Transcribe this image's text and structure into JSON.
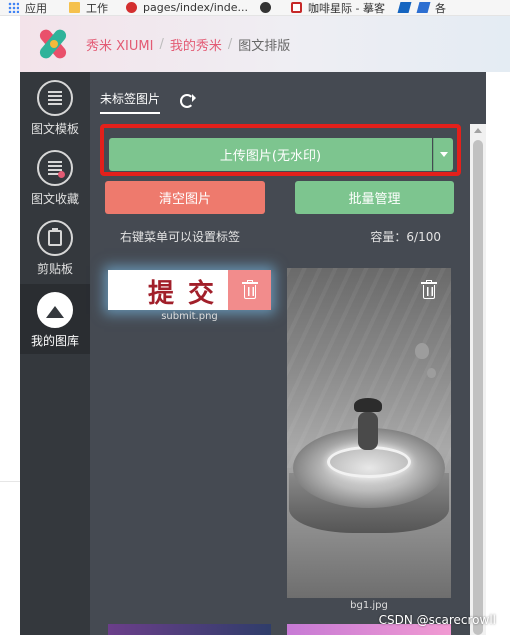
{
  "bookmarks": [
    {
      "label": "应用",
      "icon": "apps-grid-icon"
    },
    {
      "label": "工作",
      "icon": "folder-icon"
    },
    {
      "label": "pages/index/inde...",
      "icon": "page-icon"
    },
    {
      "label": "",
      "icon": "github-icon"
    },
    {
      "label": "咖啡星际 - 摹客",
      "icon": "bookmark-icon"
    },
    {
      "label": "",
      "icon": "bookmark-icon"
    },
    {
      "label": "各",
      "icon": "bookmark-icon"
    }
  ],
  "header": {
    "brand": "秀米 XIUMI",
    "link": "我的秀米",
    "current": "图文排版",
    "separator": "/"
  },
  "sidebar": {
    "items": [
      {
        "label": "图文模板",
        "icon": "template-icon",
        "active": false
      },
      {
        "label": "图文收藏",
        "icon": "favorites-icon",
        "active": false
      },
      {
        "label": "剪贴板",
        "icon": "clipboard-icon",
        "active": false
      },
      {
        "label": "我的图库",
        "icon": "gallery-icon",
        "active": true
      }
    ]
  },
  "panel": {
    "tab_label": "未标签图片",
    "upload_label": "上传图片(无水印)",
    "clear_label": "清空图片",
    "batch_label": "批量管理",
    "hint": "右键菜单可以设置标签",
    "capacity": "容量：6/100"
  },
  "images": [
    {
      "caption": "submit.png",
      "text": "提交"
    },
    {
      "caption": "bg1.jpg"
    }
  ],
  "watermark": "CSDN @scarecrowll",
  "colors": {
    "accent_green": "#7dc58f",
    "accent_red": "#ee7a6d",
    "highlight_border": "#e3201b",
    "brand": "#e35b74"
  }
}
